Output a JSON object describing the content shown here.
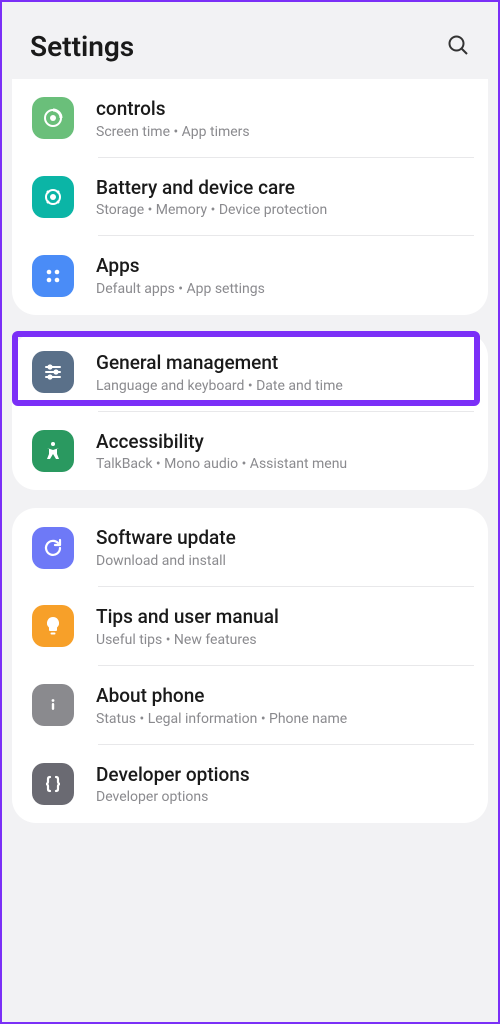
{
  "header": {
    "title": "Settings"
  },
  "sections": [
    {
      "items": [
        {
          "id": "controls",
          "title": "controls",
          "sub": "Screen time  •  App timers",
          "iconColor": "bg-green1"
        },
        {
          "id": "battery",
          "title": "Battery and device care",
          "sub": "Storage  •  Memory  •  Device protection",
          "iconColor": "bg-teal"
        },
        {
          "id": "apps",
          "title": "Apps",
          "sub": "Default apps  •  App settings",
          "iconColor": "bg-blue"
        }
      ]
    },
    {
      "items": [
        {
          "id": "general",
          "title": "General management",
          "sub": "Language and keyboard  •  Date and time",
          "iconColor": "bg-slate",
          "highlighted": true
        },
        {
          "id": "accessibility",
          "title": "Accessibility",
          "sub": "TalkBack  •  Mono audio  •  Assistant menu",
          "iconColor": "bg-green2"
        }
      ]
    },
    {
      "items": [
        {
          "id": "software",
          "title": "Software update",
          "sub": "Download and install",
          "iconColor": "bg-indigo"
        },
        {
          "id": "tips",
          "title": "Tips and user manual",
          "sub": "Useful tips  •  New features",
          "iconColor": "bg-orange"
        },
        {
          "id": "about",
          "title": "About phone",
          "sub": "Status  •  Legal information  •  Phone name",
          "iconColor": "bg-gray"
        },
        {
          "id": "developer",
          "title": "Developer options",
          "sub": "Developer options",
          "iconColor": "bg-gray2"
        }
      ]
    }
  ]
}
